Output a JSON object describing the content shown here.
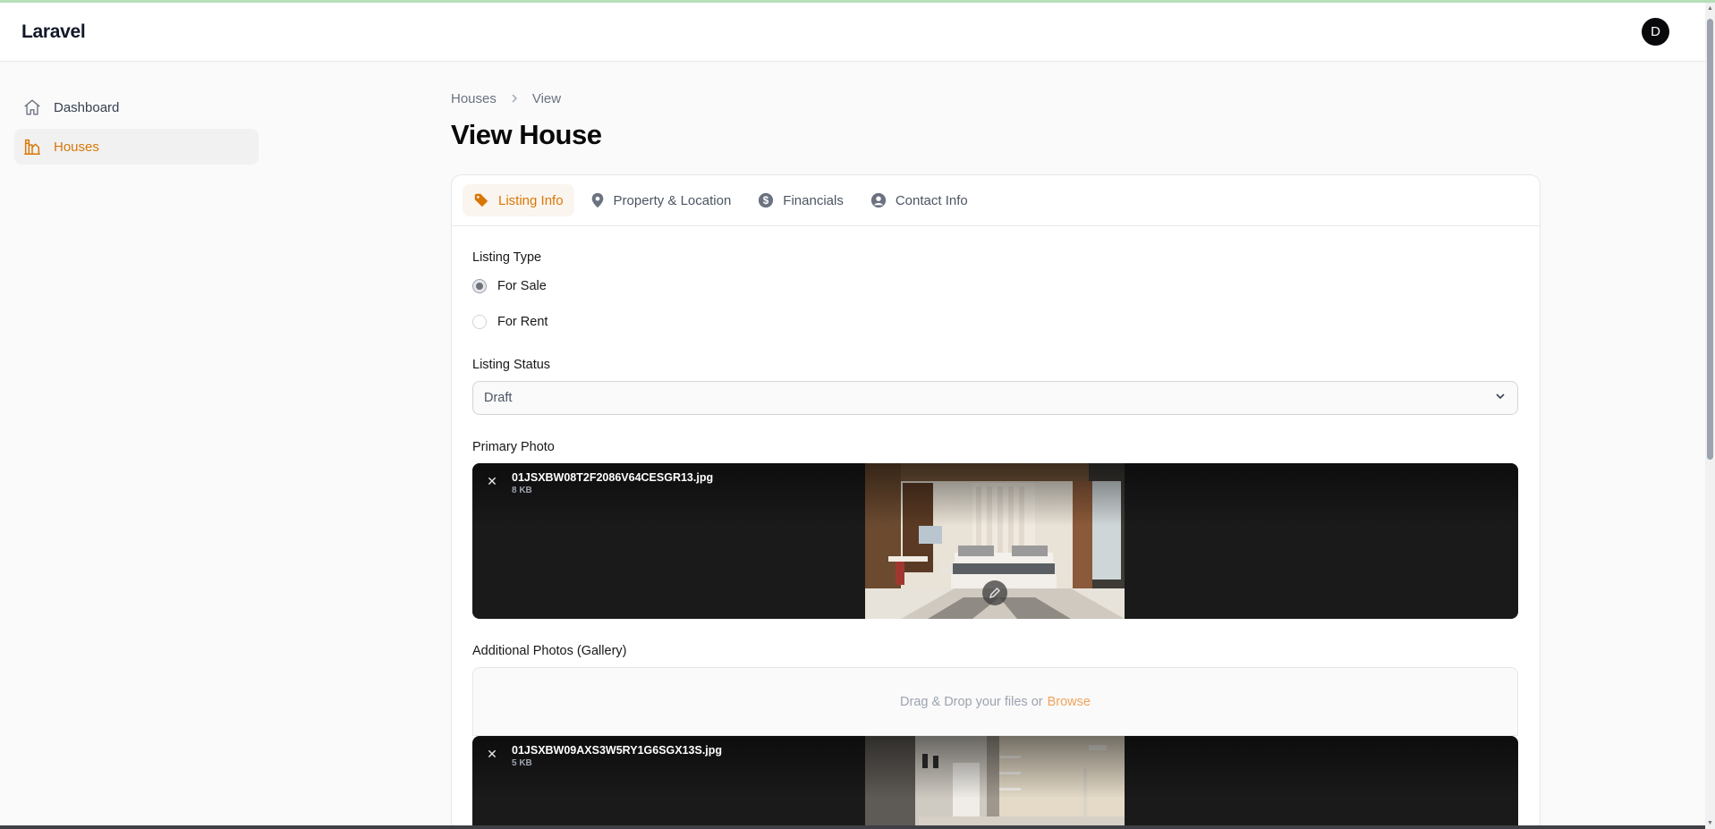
{
  "app": {
    "brand": "Laravel",
    "user_initial": "D"
  },
  "sidebar": {
    "items": [
      {
        "label": "Dashboard",
        "icon": "home-icon",
        "active": false
      },
      {
        "label": "Houses",
        "icon": "building-chart-icon",
        "active": true
      }
    ]
  },
  "breadcrumb": {
    "items": [
      "Houses",
      "View"
    ]
  },
  "page": {
    "title": "View House"
  },
  "tabs": [
    {
      "label": "Listing Info",
      "icon": "tag-icon",
      "active": true
    },
    {
      "label": "Property & Location",
      "icon": "map-pin-icon",
      "active": false
    },
    {
      "label": "Financials",
      "icon": "dollar-circle-icon",
      "active": false
    },
    {
      "label": "Contact Info",
      "icon": "user-circle-icon",
      "active": false
    }
  ],
  "form": {
    "listing_type": {
      "label": "Listing Type",
      "options": [
        {
          "label": "For Sale",
          "checked": true
        },
        {
          "label": "For Rent",
          "checked": false
        }
      ]
    },
    "listing_status": {
      "label": "Listing Status",
      "value": "Draft"
    },
    "primary_photo": {
      "label": "Primary Photo",
      "file_name": "01JSXBW08T2F2086V64CESGR13.jpg",
      "file_size": "8 KB"
    },
    "gallery": {
      "label": "Additional Photos (Gallery)",
      "drop_text": "Drag & Drop your files or",
      "browse_label": "Browse",
      "files": [
        {
          "file_name": "01JSXBW09AXS3W5RY1G6SGX13S.jpg",
          "file_size": "5 KB"
        }
      ]
    }
  },
  "colors": {
    "accent": "#d97706",
    "photo_bg": "#1a1a1a"
  }
}
